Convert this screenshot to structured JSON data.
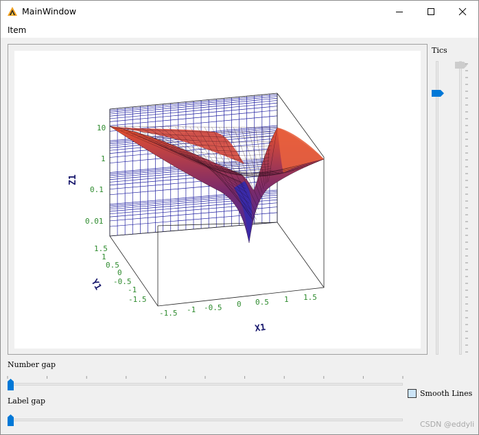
{
  "window": {
    "title": "MainWindow",
    "icon": "qt-app-icon",
    "controls": [
      "minimize-icon",
      "maximize-icon",
      "close-icon"
    ]
  },
  "menu": {
    "items": [
      "Item"
    ]
  },
  "plot": {
    "axis_labels": {
      "x": "X1",
      "y": "Y1",
      "z": "Z1"
    },
    "x_ticks": [
      "-1.5",
      "-1",
      "-0.5",
      "0",
      "0.5",
      "1",
      "1.5"
    ],
    "y_ticks": [
      "1.5",
      "1",
      "0.5",
      "0",
      "-0.5",
      "-1",
      "-1.5"
    ],
    "z_ticks": [
      "10",
      "1",
      "0.1",
      "0.01"
    ],
    "colors": {
      "tick_text": "#2e8b2e",
      "axis_label": "#1a1a6e",
      "grid": "#1f1fa0",
      "surface_low": "#3a2aa8",
      "surface_high": "#e8502c"
    }
  },
  "controls": {
    "tics_label": "Tics",
    "number_gap_label": "Number gap",
    "label_gap_label": "Label gap",
    "smooth_lines_label": "Smooth Lines",
    "smooth_lines_checked": false
  },
  "watermark": "CSDN @eddyli"
}
